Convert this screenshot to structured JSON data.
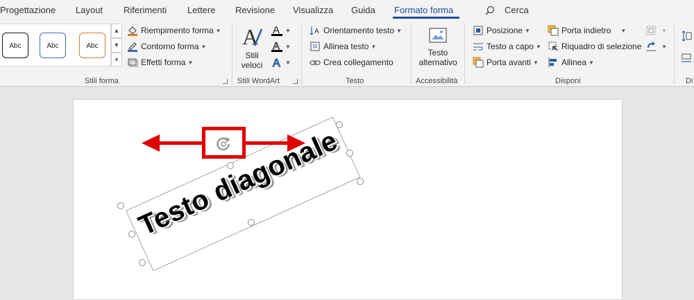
{
  "tabs": [
    "Progettazione",
    "Layout",
    "Riferimenti",
    "Lettere",
    "Revisione",
    "Visualizza",
    "Guida",
    "Formato forma"
  ],
  "active_tab": "Formato forma",
  "search": {
    "label": "Cerca"
  },
  "ribbon": {
    "stili_forma": {
      "label": "Stili forma",
      "gallery": [
        "Abc",
        "Abc",
        "Abc"
      ],
      "commands": [
        "Riempimento forma",
        "Contorno forma",
        "Effetti forma"
      ]
    },
    "stili_wordart": {
      "label": "Stili WordArt",
      "quick_styles": "Stili veloci"
    },
    "testo": {
      "label": "Testo",
      "commands": [
        "Orientamento testo",
        "Allinea testo",
        "Crea collegamento"
      ]
    },
    "accessibilita": {
      "label": "Accessibilità",
      "alt_text": "Testo alternativo"
    },
    "disponi": {
      "label": "Disponi",
      "col1": [
        "Posizione",
        "Testo a capo",
        "Porta avanti"
      ],
      "col2": [
        "Porta indietro",
        "Riquadro di selezione",
        "Allinea"
      ]
    },
    "next_group_partial": "Di"
  },
  "document": {
    "shape_text": "Testo diagonale"
  },
  "colors": {
    "accent": "#1f4e9a",
    "annotation": "#e00000"
  }
}
